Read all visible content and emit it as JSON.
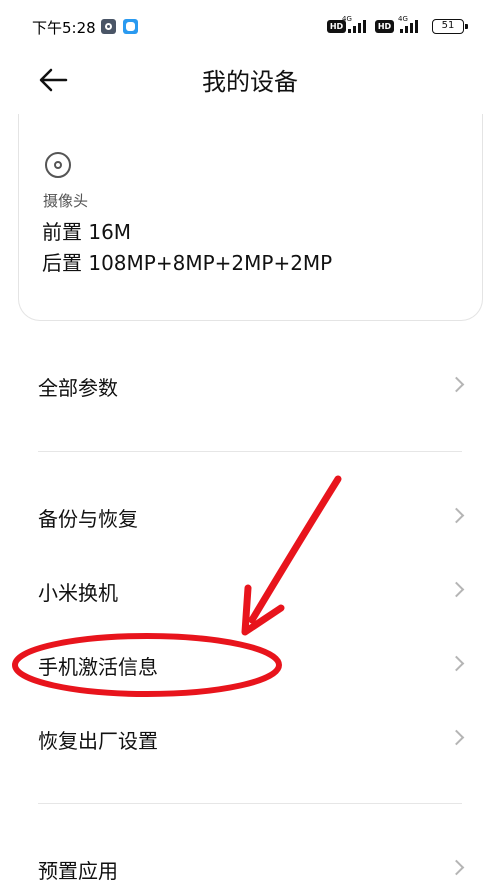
{
  "status_bar": {
    "time": "下午5:28",
    "network_1": "4G",
    "network_2": "4G",
    "hd_label": "HD",
    "battery": "51",
    "icons": [
      "gear-icon",
      "app-icon",
      "hd-icon",
      "signal-icon",
      "battery-icon"
    ]
  },
  "header": {
    "title": "我的设备",
    "back_icon": "arrow-left-icon"
  },
  "camera_card": {
    "icon": "camera-lens-icon",
    "label": "摄像头",
    "front": "前置 16M",
    "rear": "后置 108MP+8MP+2MP+2MP"
  },
  "menu": {
    "all_params": "全部参数",
    "backup_restore": "备份与恢复",
    "mi_mover": "小米换机",
    "activation_info": "手机激活信息",
    "factory_reset": "恢复出厂设置",
    "preinstalled_apps": "预置应用"
  },
  "annotation": {
    "color": "#e8141c",
    "highlighted_item": "手机激活信息"
  }
}
